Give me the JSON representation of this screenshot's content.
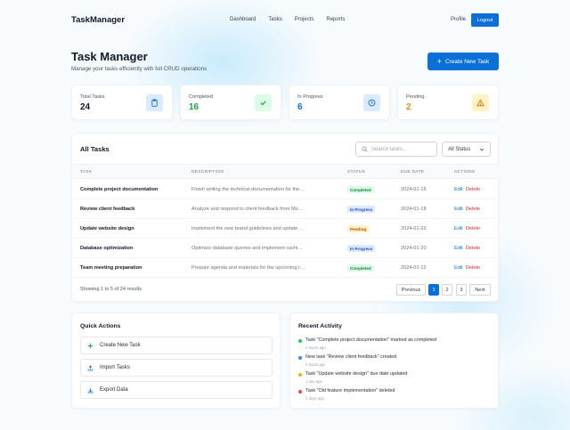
{
  "nav": {
    "brand": "TaskManager",
    "links": [
      "Dashboard",
      "Tasks",
      "Projects",
      "Reports"
    ],
    "profile": "Profile",
    "logout": "Logout"
  },
  "header": {
    "title": "Task Manager",
    "subtitle": "Manage your tasks efficiently with full CRUD operations",
    "create_button": "Create New Task"
  },
  "stats": [
    {
      "label": "Total Tasks",
      "value": "24",
      "value_color": "#111827",
      "icon": "clipboard-icon",
      "icon_bg": "#dbeafe",
      "icon_color": "#0b6fd8"
    },
    {
      "label": "Completed",
      "value": "16",
      "value_color": "#16a34a",
      "icon": "check-icon",
      "icon_bg": "#dcfce7",
      "icon_color": "#16a34a"
    },
    {
      "label": "In Progress",
      "value": "6",
      "value_color": "#0b6fd8",
      "icon": "clock-icon",
      "icon_bg": "#dbeafe",
      "icon_color": "#0b6fd8"
    },
    {
      "label": "Pending",
      "value": "2",
      "value_color": "#ea8a0c",
      "icon": "warning-icon",
      "icon_bg": "#fef3c7",
      "icon_color": "#d97706"
    }
  ],
  "tasks_table": {
    "title": "All Tasks",
    "search_placeholder": "Search tasks...",
    "status_filter": "All Status",
    "columns": [
      "TASK",
      "DESCRIPTION",
      "STATUS",
      "DUE DATE",
      "ACTIONS"
    ],
    "rows": [
      {
        "task": "Complete project documentation",
        "description": "Finish writing the technical documentation for the project",
        "status": "Completed",
        "due": "2024-01-15"
      },
      {
        "task": "Review client feedback",
        "description": "Analyze and respond to client feedback from Monday meeting",
        "status": "In Progress",
        "due": "2024-01-18"
      },
      {
        "task": "Update website design",
        "description": "Implement the new brand guidelines and update the homepage",
        "status": "Pending",
        "due": "2024-01-22"
      },
      {
        "task": "Database optimization",
        "description": "Optimize database queries and implement caching strategy",
        "status": "In Progress",
        "due": "2024-01-20"
      },
      {
        "task": "Team meeting preparation",
        "description": "Prepare agenda and materials for the upcoming team meeting",
        "status": "Completed",
        "due": "2024-01-12"
      }
    ],
    "edit_label": "Edit",
    "delete_label": "Delete",
    "showing": "Showing 1 to 5 of 24 results",
    "pagination": {
      "previous": "Previous",
      "pages": [
        "1",
        "2",
        "3"
      ],
      "next": "Next",
      "current": "1"
    }
  },
  "status_colors": {
    "Completed": {
      "bg": "#dcfce7",
      "fg": "#15803d"
    },
    "In Progress": {
      "bg": "#dbeafe",
      "fg": "#1d4ed8"
    },
    "Pending": {
      "bg": "#fef3c7",
      "fg": "#b45309"
    }
  },
  "quick_actions": {
    "title": "Quick Actions",
    "items": [
      {
        "label": "Create New Task",
        "icon": "plus-icon"
      },
      {
        "label": "Import Tasks",
        "icon": "upload-icon"
      },
      {
        "label": "Export Data",
        "icon": "download-icon"
      }
    ]
  },
  "recent_activity": {
    "title": "Recent Activity",
    "items": [
      {
        "text": "Task \"Complete project documentation\" marked as completed",
        "time": "2 hours ago",
        "color": "#22c55e"
      },
      {
        "text": "New task \"Review client feedback\" created",
        "time": "4 hours ago",
        "color": "#3b82f6"
      },
      {
        "text": "Task \"Update website design\" due date updated",
        "time": "1 day ago",
        "color": "#eab308"
      },
      {
        "text": "Task \"Old feature implementation\" deleted",
        "time": "2 days ago",
        "color": "#ef4444"
      }
    ]
  }
}
